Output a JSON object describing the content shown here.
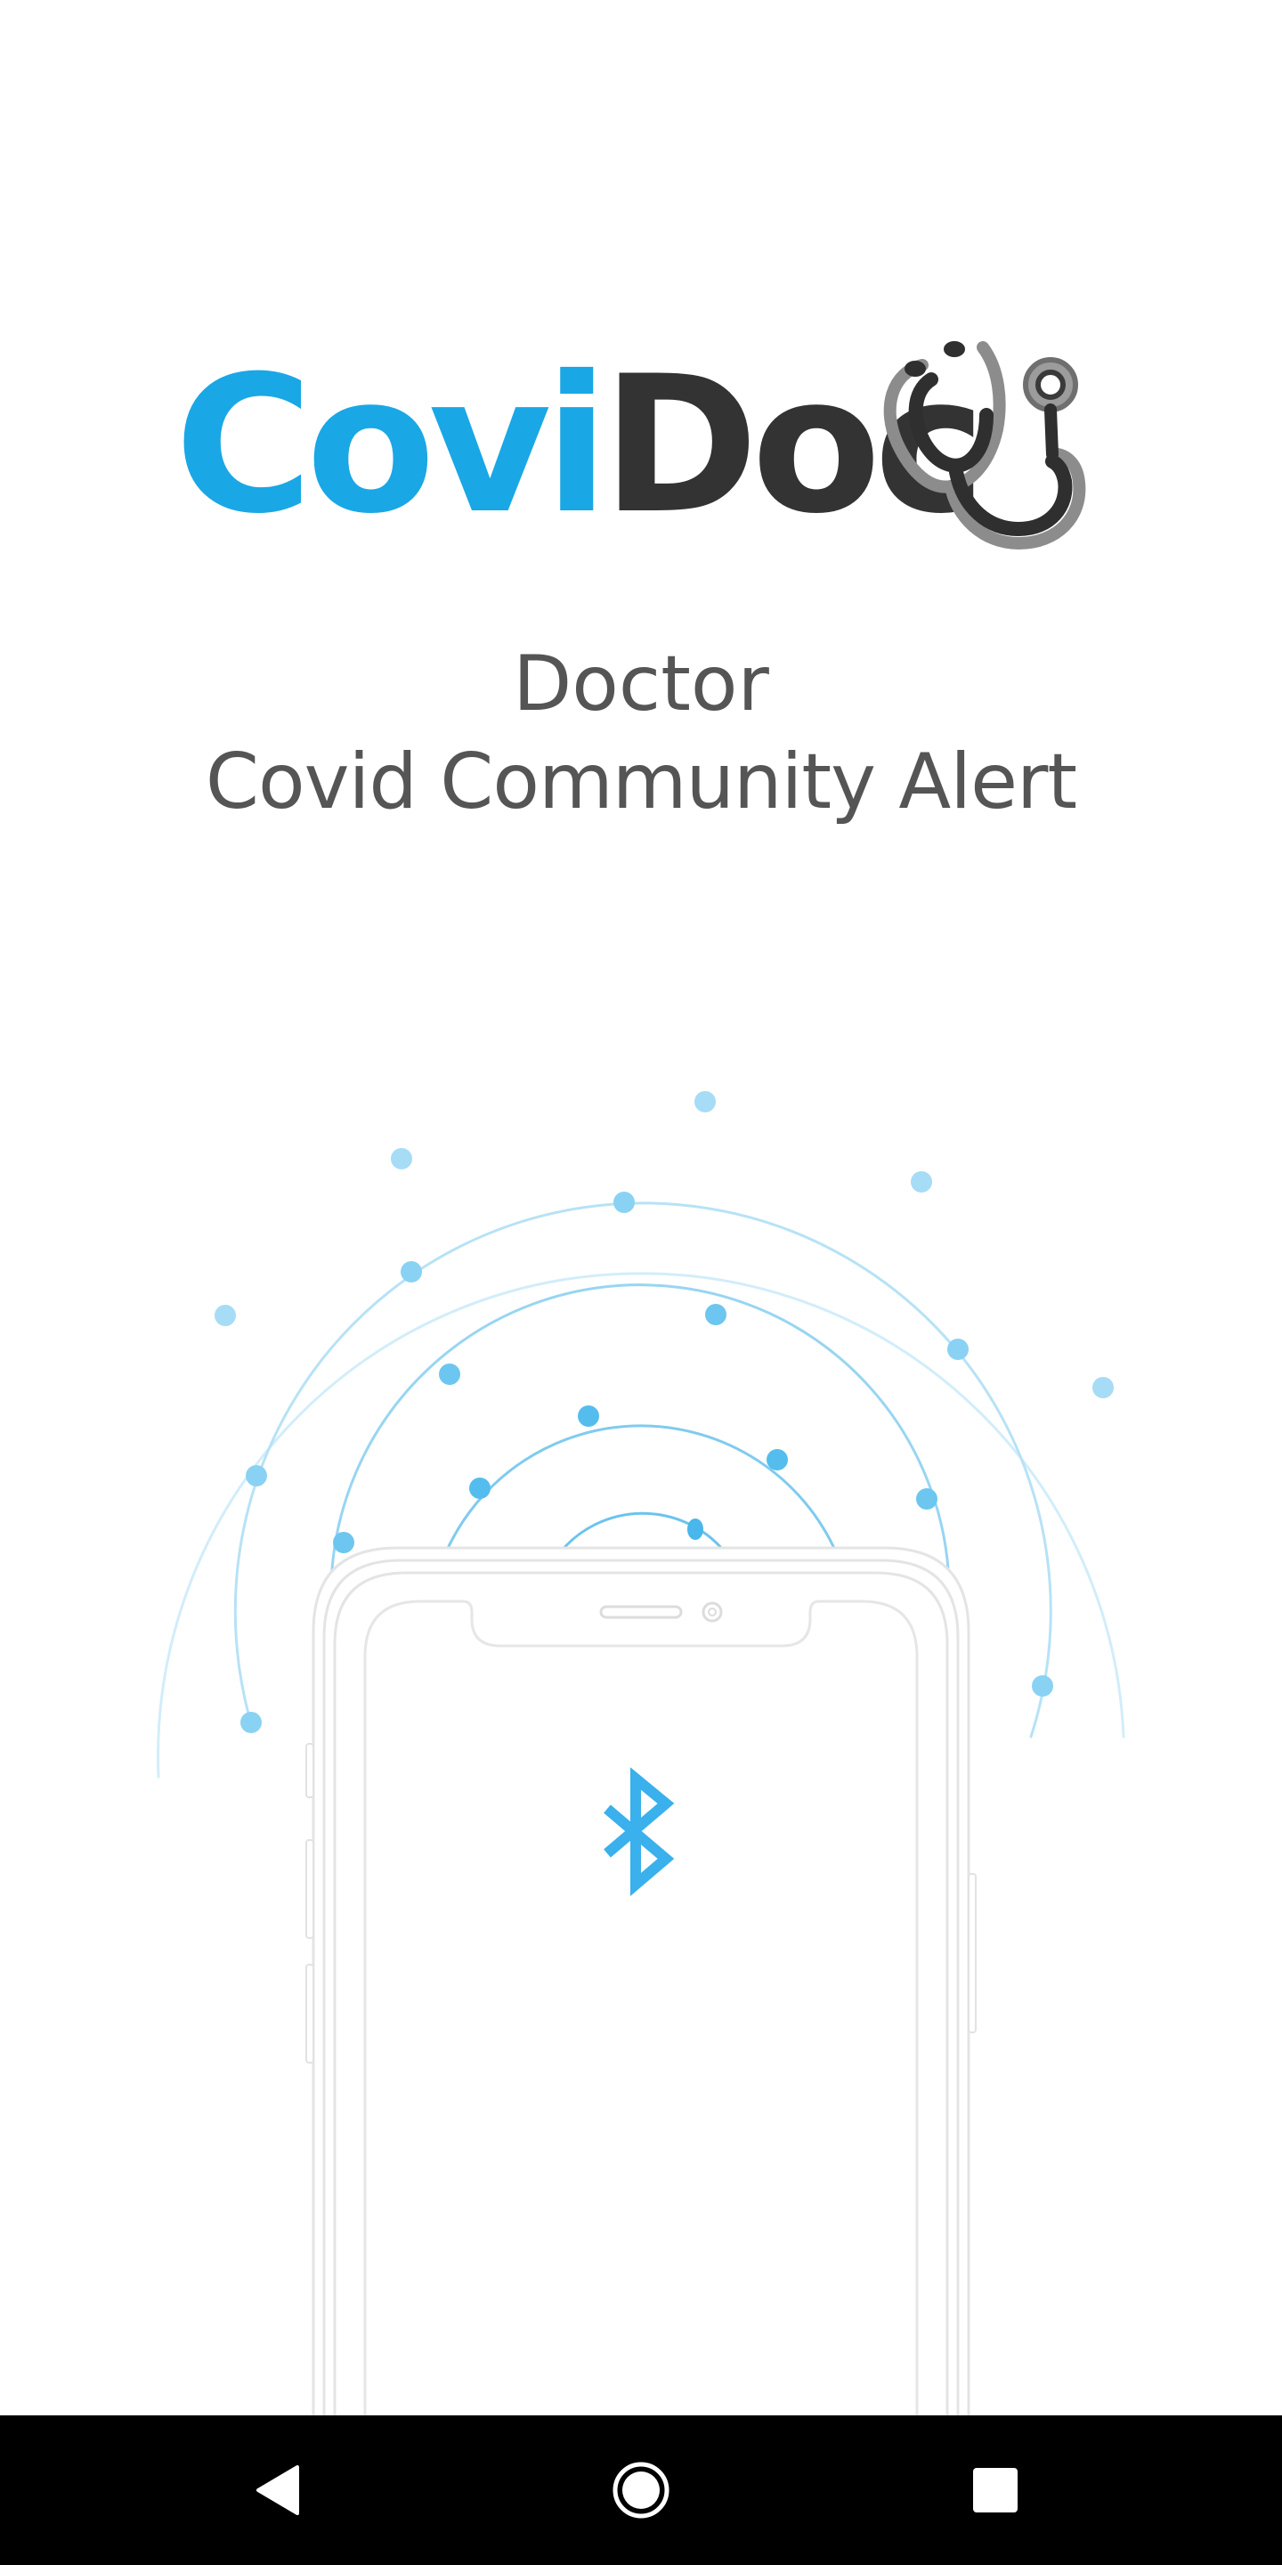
{
  "app": {
    "logo_part1": "Covi",
    "logo_part2": "Doc",
    "logo_color_primary": "#1aa7e5",
    "logo_color_secondary": "#333333",
    "logo_icon": "stethoscope-icon"
  },
  "subtitle": {
    "line1": "Doctor",
    "line2": "Covid Community Alert"
  },
  "illustration": {
    "center_icon": "bluetooth-icon",
    "signal_color": "#4bb8ec",
    "phone_outline_color": "#e0e0e0"
  },
  "navbar": {
    "back_icon": "back-triangle-icon",
    "home_icon": "home-circle-icon",
    "recent_icon": "recent-square-icon"
  }
}
